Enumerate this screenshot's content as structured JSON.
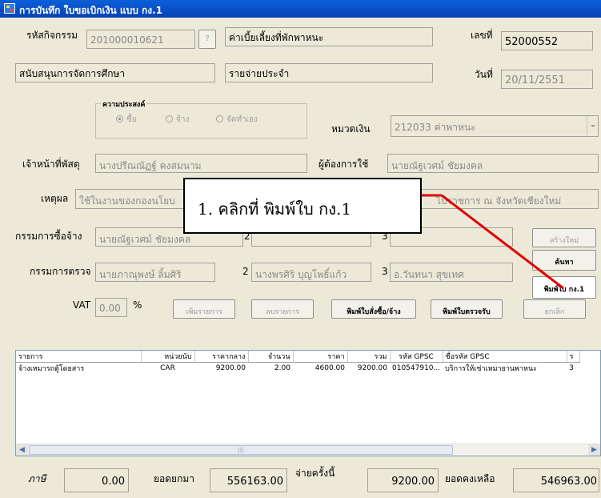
{
  "window": {
    "title": "การบันทึก ใบขอเบิกเงิน แบบ กง.1"
  },
  "header": {
    "activity_label": "รหัสกิจกรรม",
    "activity_code": "201000010621",
    "lookup_button": "?",
    "activity_name": "ค่าเบี้ยเลี้ยงที่พักพาหนะ",
    "number_label": "เลขที่",
    "number_value": "52000552",
    "project_name": "สนับสนุนการจัดการศึกษา",
    "budget_type": "รายจ่ายประจำ",
    "date_label": "วันที่",
    "date_value": "20/11/2551"
  },
  "purpose": {
    "group_title": "ความประสงค์",
    "options": [
      "ซื้อ",
      "จ้าง",
      "จัดทำเอง"
    ],
    "selected_index": 0
  },
  "money_category": {
    "label": "หมวดเงิน",
    "value": "212033 ค่าพาหนะ"
  },
  "officer": {
    "label": "เจ้าหน้าที่พัสดุ",
    "value": "นางปรีณณัฏฐ์ คงสมนาม"
  },
  "requester": {
    "label": "ผู้ต้องการใช้",
    "value": "นายณัฐเวศม์ ชัยมงคล"
  },
  "reason": {
    "label": "เหตุผล",
    "value_start": "ใช้ในงานของกองนโยบ",
    "value_end": "ไปราชการ ณ จังหวัดเชียงใหม่"
  },
  "purchase_committee": {
    "label": "กรรมการซื้อจ้าง",
    "member1": "นายณัฐเวศม์ ชัยมงคล",
    "num2": "2",
    "member2": "",
    "num3": "3",
    "member3": ""
  },
  "inspection_committee": {
    "label": "กรรมการตรวจ",
    "member1": "นายภาณุพงษ์ ลิ้มศิริ",
    "num2": "2",
    "member2": "นางพรศิริ บุญโพธิ์แก้ว",
    "num3": "3",
    "member3": "อ.วันทนา สุขเทศ"
  },
  "vat": {
    "label": "VAT",
    "value": "0.00",
    "unit": "%"
  },
  "buttons": {
    "add_item": "เพิ่มรายการ",
    "delete_item": "ลบรายการ",
    "print_order": "พิมพ์ใบสั่งซื้อ/จ้าง",
    "print_receive": "พิมพ์ใบตรวจรับ",
    "cancel": "ยกเลิก",
    "create_new": "สร้างใหม่",
    "search": "ค้นหา",
    "print_form": "พิมพ์ใบ กง.1"
  },
  "grid": {
    "columns": [
      "รายการ",
      "หน่วยนับ",
      "ราคากลาง",
      "จำนวน",
      "ราคา",
      "รวม",
      "รหัส GPSC",
      "ชื่อรหัส GPSC",
      "ร"
    ],
    "rows": [
      [
        "จ้างเหมารถตู้โดยสาร",
        "CAR",
        "9200.00",
        "2.00",
        "4600.00",
        "9200.00",
        "010547910...",
        "บริการให้เช่าเหมายานพาหนะ",
        "3"
      ]
    ]
  },
  "footer": {
    "tax_label": "ภาษี",
    "tax_value": "0.00",
    "carried_label": "ยอดยกมา",
    "carried_value": "556163.00",
    "spend_label": "จ่ายครั้งนี้",
    "spend_value": "9200.00",
    "remaining_label": "ยอดคงเหลือ",
    "remaining_value": "546963.00"
  },
  "annotation": {
    "text": "1. คลิกที่ พิมพ์ใบ กง.1",
    "color": "#e00000"
  }
}
